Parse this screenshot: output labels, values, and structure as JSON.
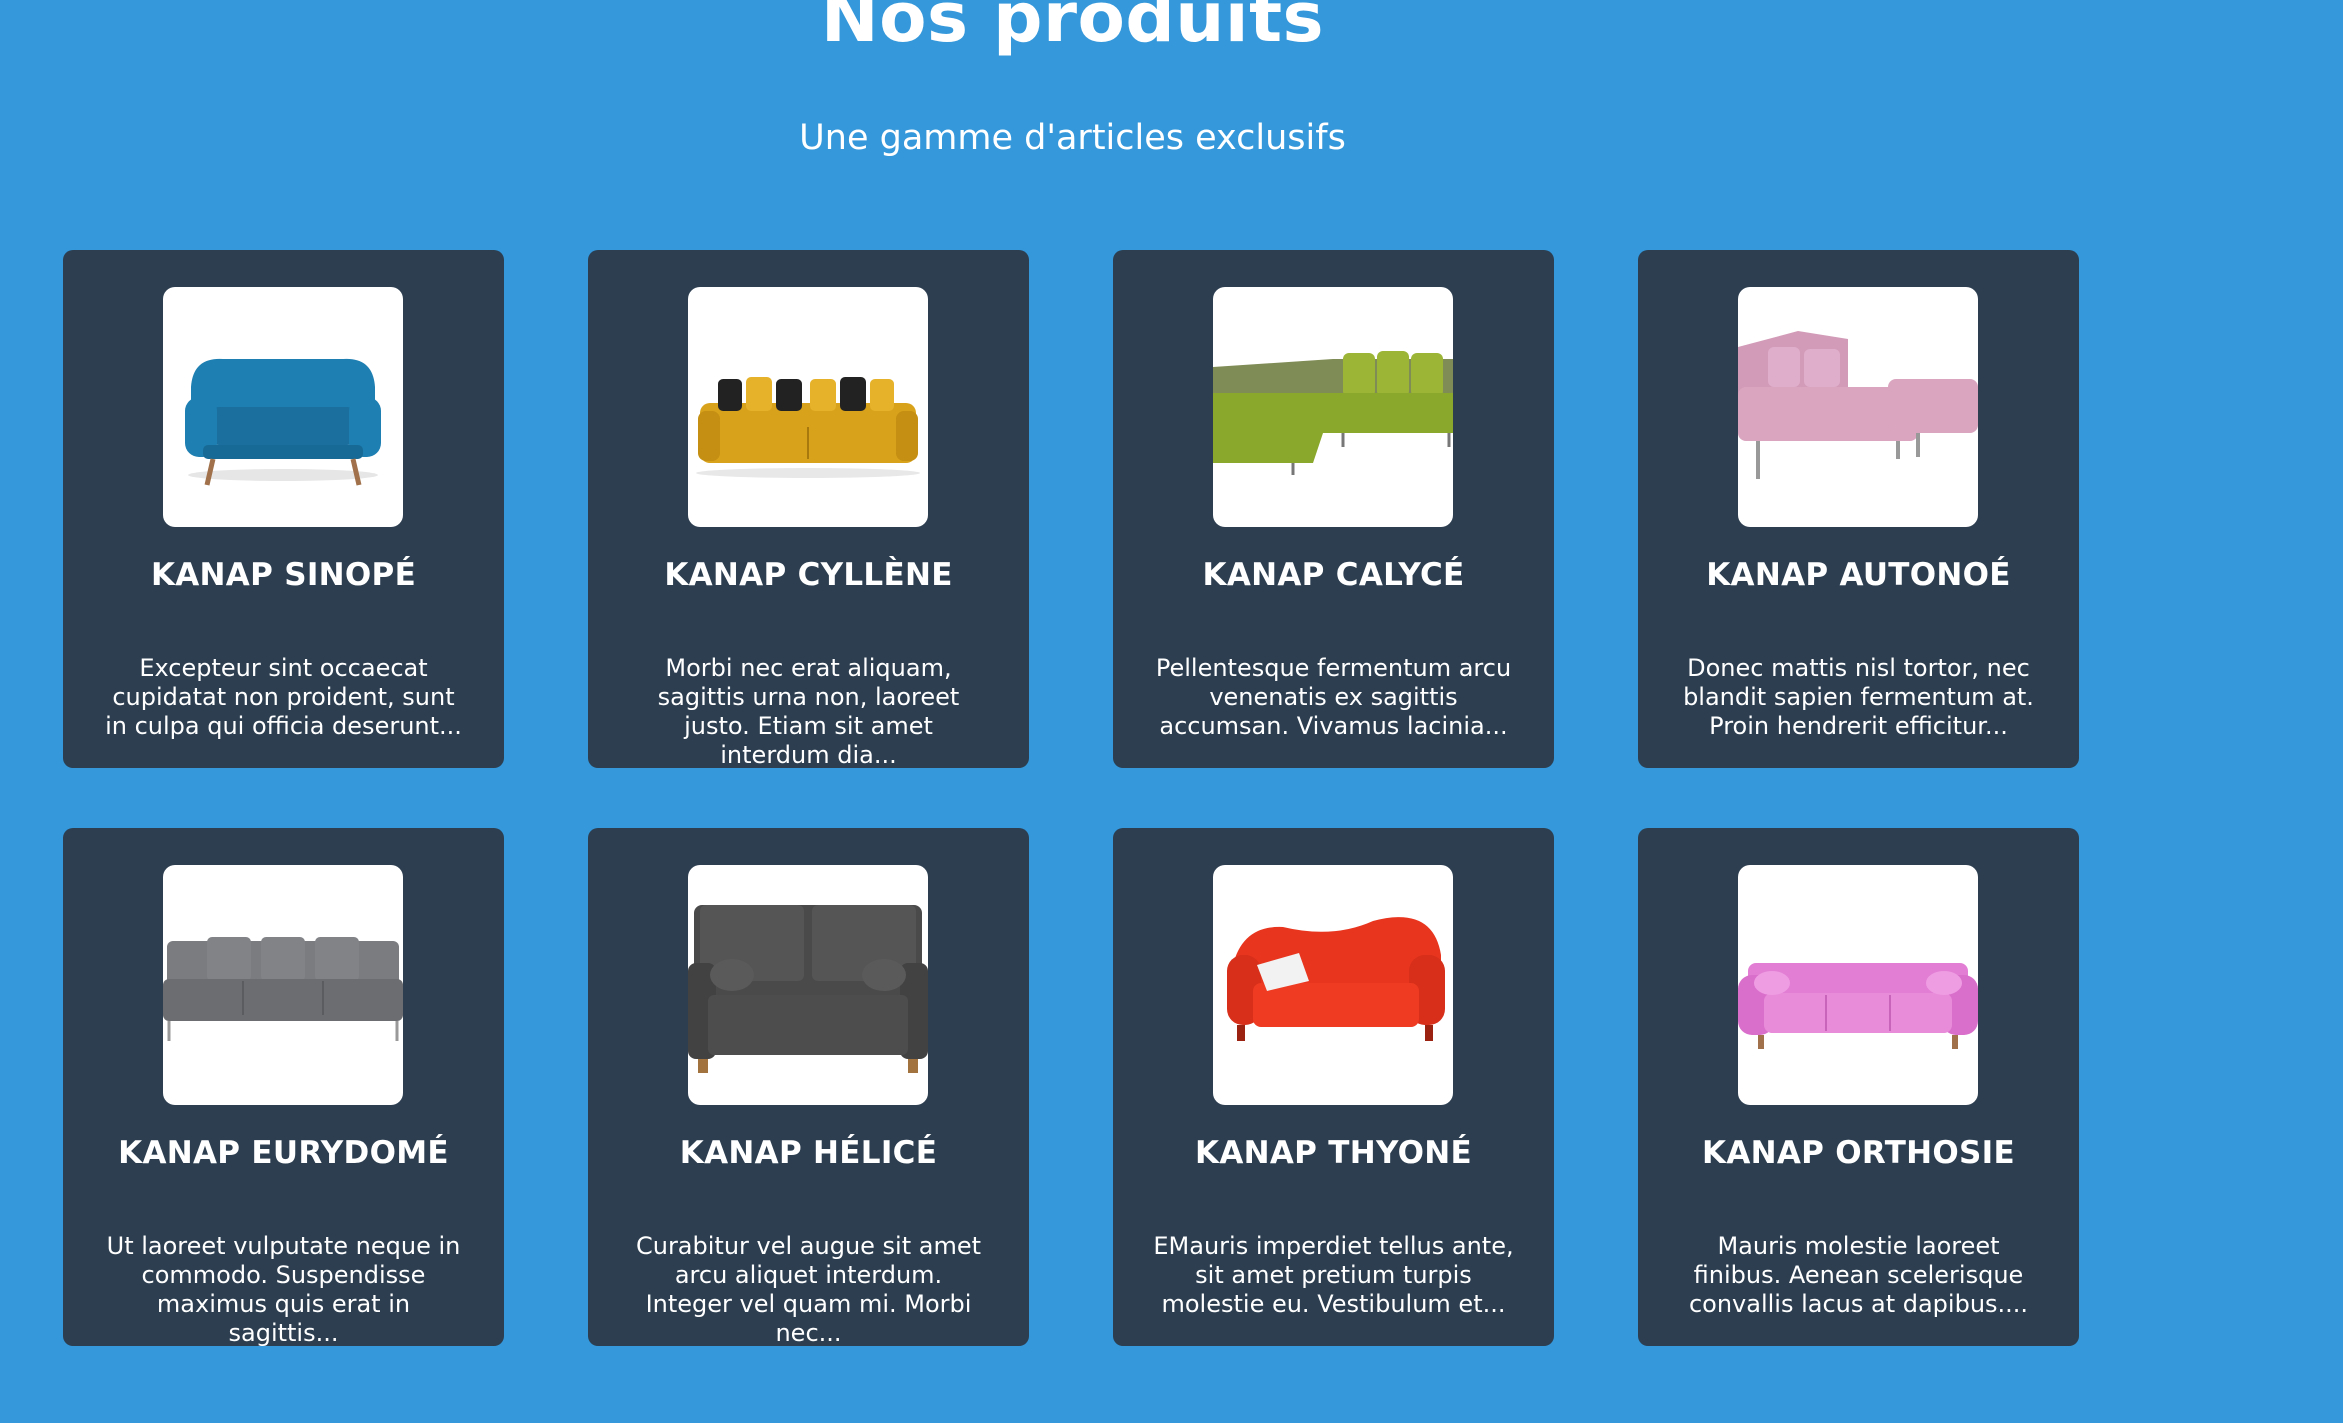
{
  "header": {
    "title": "Nos produits",
    "subtitle": "Une gamme d'articles exclusifs"
  },
  "colors": {
    "background": "#3498db",
    "card": "#2c3e50",
    "text": "#ffffff"
  },
  "products": [
    {
      "name": "KANAP SINOPÉ",
      "description": "Excepteur sint occaecat cupidatat non proident, sunt in culpa qui officia deserunt...",
      "image_icon": "blue-armchair-sofa-icon",
      "sofa_color": "#1e7fb2"
    },
    {
      "name": "KANAP CYLLÈNE",
      "description": "Morbi nec erat aliquam, sagittis urna non, laoreet justo. Etiam sit amet interdum dia...",
      "image_icon": "yellow-sofa-icon",
      "sofa_color": "#d9a21b"
    },
    {
      "name": "KANAP CALYCÉ",
      "description": "Pellentesque fermentum arcu venenatis ex sagittis accumsan. Vivamus lacinia...",
      "image_icon": "green-corner-sofa-icon",
      "sofa_color": "#8aa82b"
    },
    {
      "name": "KANAP AUTONOÉ",
      "description": "Donec mattis nisl tortor, nec blandit sapien fermentum at. Proin hendrerit efficitur...",
      "image_icon": "pink-chaise-sofa-icon",
      "sofa_color": "#d9a5bf"
    },
    {
      "name": "KANAP EURYDOMÉ",
      "description": "Ut laoreet vulputate neque in commodo. Suspendisse maximus quis erat in sagittis...",
      "image_icon": "grey-three-seat-sofa-icon",
      "sofa_color": "#6b6d70"
    },
    {
      "name": "KANAP HÉLICÉ",
      "description": "Curabitur vel augue sit amet arcu aliquet interdum. Integer vel quam mi. Morbi nec...",
      "image_icon": "dark-grey-sofa-icon",
      "sofa_color": "#4a4a4a"
    },
    {
      "name": "KANAP THYONÉ",
      "description": "EMauris imperdiet tellus ante, sit amet pretium turpis molestie eu. Vestibulum et...",
      "image_icon": "red-sofa-icon",
      "sofa_color": "#e8351e"
    },
    {
      "name": "KANAP ORTHOSIE",
      "description": "Mauris molestie laoreet finibus. Aenean scelerisque convallis lacus at dapibus....",
      "image_icon": "pink-chesterfield-sofa-icon",
      "sofa_color": "#e27fd4"
    }
  ]
}
